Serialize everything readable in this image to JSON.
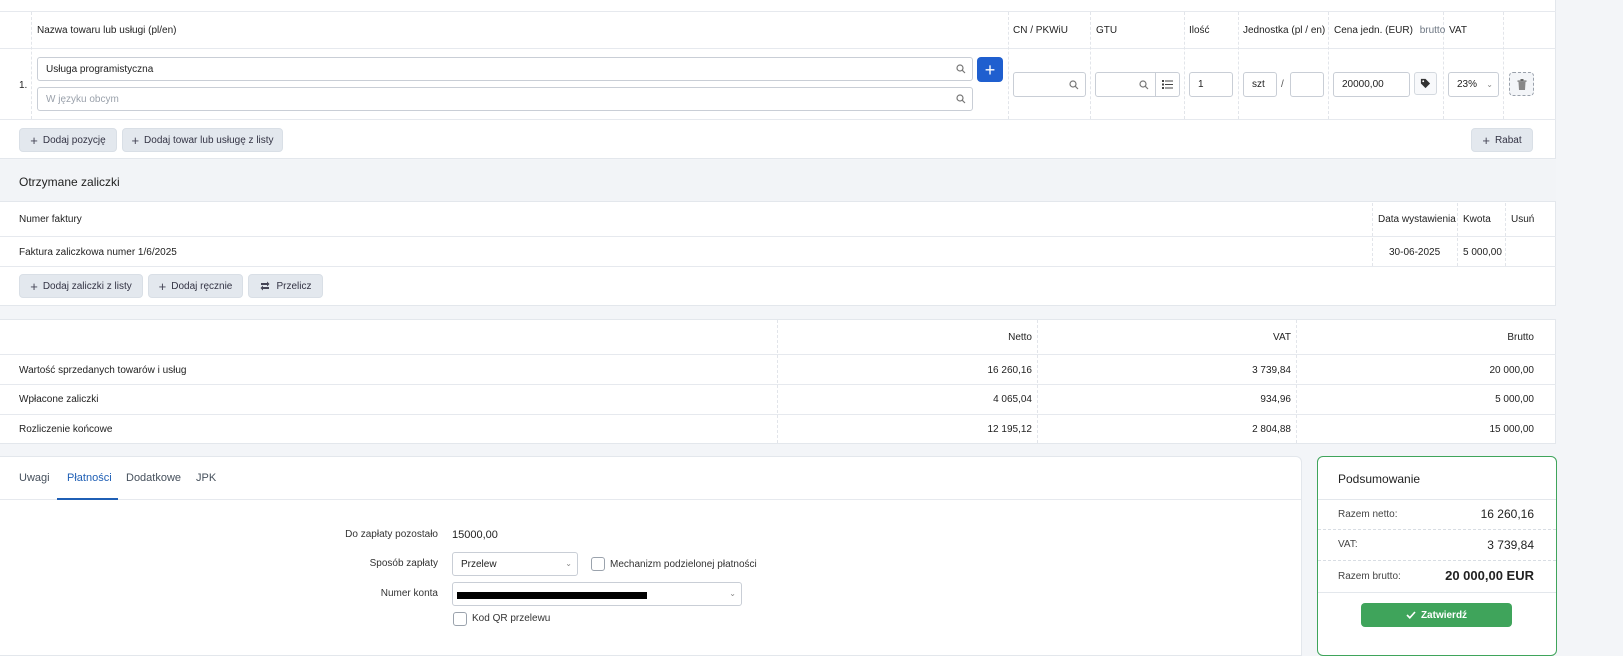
{
  "items_table": {
    "headers": {
      "name": "Nazwa towaru lub usługi (pl/en)",
      "cn": "CN / PKWiU",
      "gtu": "GTU",
      "qty": "Ilość",
      "unit": "Jednostka (pl / en)",
      "price": "Cena jedn. (EUR)",
      "price_mode": "brutto",
      "vat": "VAT"
    },
    "rows": [
      {
        "index": "1.",
        "name": "Usługa programistyczna",
        "foreign_placeholder": "W języku obcym",
        "qty": "1",
        "unit_pl": "szt",
        "unit_sep": "/",
        "price": "20000,00",
        "vat": "23%"
      }
    ],
    "add_position": "Dodaj pozycję",
    "add_from_list": "Dodaj towar lub usługę z listy",
    "discount": "Rabat"
  },
  "advances": {
    "title": "Otrzymane zaliczki",
    "headers": {
      "invoice_no": "Numer faktury",
      "issue_date": "Data wystawienia",
      "amount": "Kwota",
      "remove": "Usuń"
    },
    "rows": [
      {
        "invoice": "Faktura zaliczkowa numer 1/6/2025",
        "date": "30-06-2025",
        "amount": "5 000,00"
      }
    ],
    "add_from_list": "Dodaj zaliczki z listy",
    "add_manual": "Dodaj ręcznie",
    "recalc": "Przelicz"
  },
  "totals": {
    "headers": {
      "net": "Netto",
      "vat": "VAT",
      "gross": "Brutto"
    },
    "rows": [
      {
        "label": "Wartość sprzedanych towarów i usług",
        "net": "16 260,16",
        "vat": "3 739,84",
        "gross": "20 000,00"
      },
      {
        "label": "Wpłacone zaliczki",
        "net": "4 065,04",
        "vat": "934,96",
        "gross": "5 000,00"
      },
      {
        "label": "Rozliczenie końcowe",
        "net": "12 195,12",
        "vat": "2 804,88",
        "gross": "15 000,00"
      }
    ]
  },
  "tabs": [
    {
      "label": "Uwagi"
    },
    {
      "label": "Płatności"
    },
    {
      "label": "Dodatkowe"
    },
    {
      "label": "JPK"
    }
  ],
  "payments": {
    "remaining_label": "Do zapłaty pozostało",
    "remaining_value": "15000,00",
    "method_label": "Sposób zapłaty",
    "method_value": "Przelew",
    "split_payment_label": "Mechanizm podzielonej płatności",
    "account_label": "Numer konta",
    "qr_label": "Kod QR przelewu"
  },
  "summary": {
    "title": "Podsumowanie",
    "net_label": "Razem netto:",
    "net_value": "16 260,16",
    "vat_label": "VAT:",
    "vat_value": "3 739,84",
    "gross_label": "Razem brutto:",
    "gross_value": "20 000,00 EUR",
    "confirm": "Zatwierdź"
  },
  "colors": {
    "primary_blue": "#1f5fcf",
    "confirm_green": "#3fa45b",
    "redaction": "#000000"
  }
}
